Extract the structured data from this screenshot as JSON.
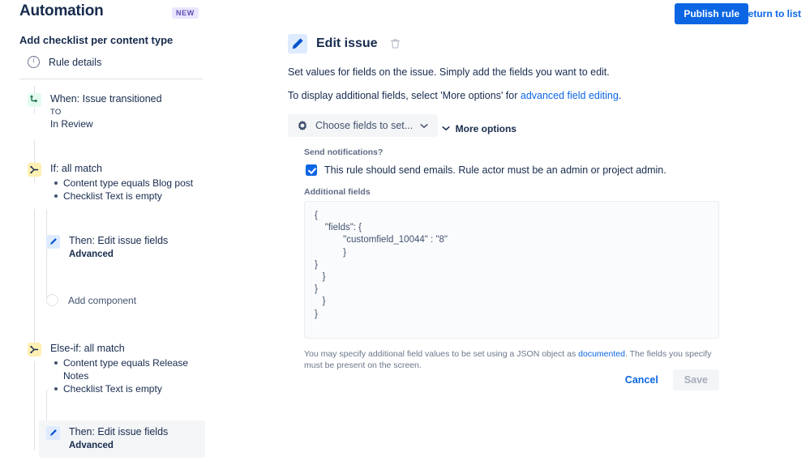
{
  "header": {
    "app_title": "Automation",
    "new_badge": "NEW",
    "publish_label": "Publish rule",
    "return_label": "Return to list"
  },
  "sidebar": {
    "rule_name": "Add checklist per content type",
    "rule_details_label": "Rule details",
    "add_component_label": "Add component",
    "nodes": [
      {
        "title": "When: Issue transitioned",
        "caption": "TO",
        "sub": "In Review",
        "icon": "trigger-icon",
        "icon_bg": "#E3FCEF",
        "icon_color": "#216E4E"
      },
      {
        "title": "If: all match",
        "icon": "condition-branch-icon",
        "icon_bg": "#FFF0B3",
        "icon_color": "#172B4D",
        "conditions": [
          "Content type equals Blog post",
          "Checklist Text is empty"
        ]
      },
      {
        "title": "Then: Edit issue fields",
        "sub_bold": "Advanced",
        "icon": "pencil-icon",
        "icon_bg": "#DEEBFF",
        "icon_color": "#0052CC",
        "selected": false
      },
      {
        "title": "Else-if: all match",
        "icon": "condition-branch-icon",
        "icon_bg": "#FFF0B3",
        "icon_color": "#172B4D",
        "conditions": [
          "Content type equals Release Notes",
          "Checklist Text is empty"
        ]
      },
      {
        "title": "Then: Edit issue fields",
        "sub_bold": "Advanced",
        "icon": "pencil-icon",
        "icon_bg": "#DEEBFF",
        "icon_color": "#0052CC",
        "selected": true
      }
    ]
  },
  "main": {
    "panel_title": "Edit issue",
    "description_1": "Set values for fields on the issue. Simply add the fields you want to edit.",
    "description_2_prefix": "To display additional fields, select 'More options' for ",
    "description_2_link": "advanced field editing",
    "description_2_suffix": ".",
    "choose_fields_label": "Choose fields to set...",
    "more_options_label": "More options",
    "send_notifications_label": "Send notifications?",
    "send_emails_text": "This rule should send emails. Rule actor must be an admin or project admin.",
    "additional_fields_label": "Additional fields",
    "additional_fields_value": "{\n    \"fields\": {\n           \"customfield_10044\" : \"8\"\n           }\n}\n   }\n}\n   }\n}",
    "json_help_prefix": "You may specify additional field values to be set using a JSON object as ",
    "json_help_link": "documented",
    "json_help_suffix": ". The fields you specify must be present on the screen.",
    "cancel_label": "Cancel",
    "save_label": "Save"
  },
  "colors": {
    "accent_blue": "#0C66E4",
    "trigger_green_bg": "#E3FCEF",
    "condition_yellow_bg": "#FFF0B3",
    "action_blue_bg": "#DEEBFF",
    "badge_purple_bg": "#EAE6FF",
    "badge_purple_text": "#5E4DB2"
  }
}
